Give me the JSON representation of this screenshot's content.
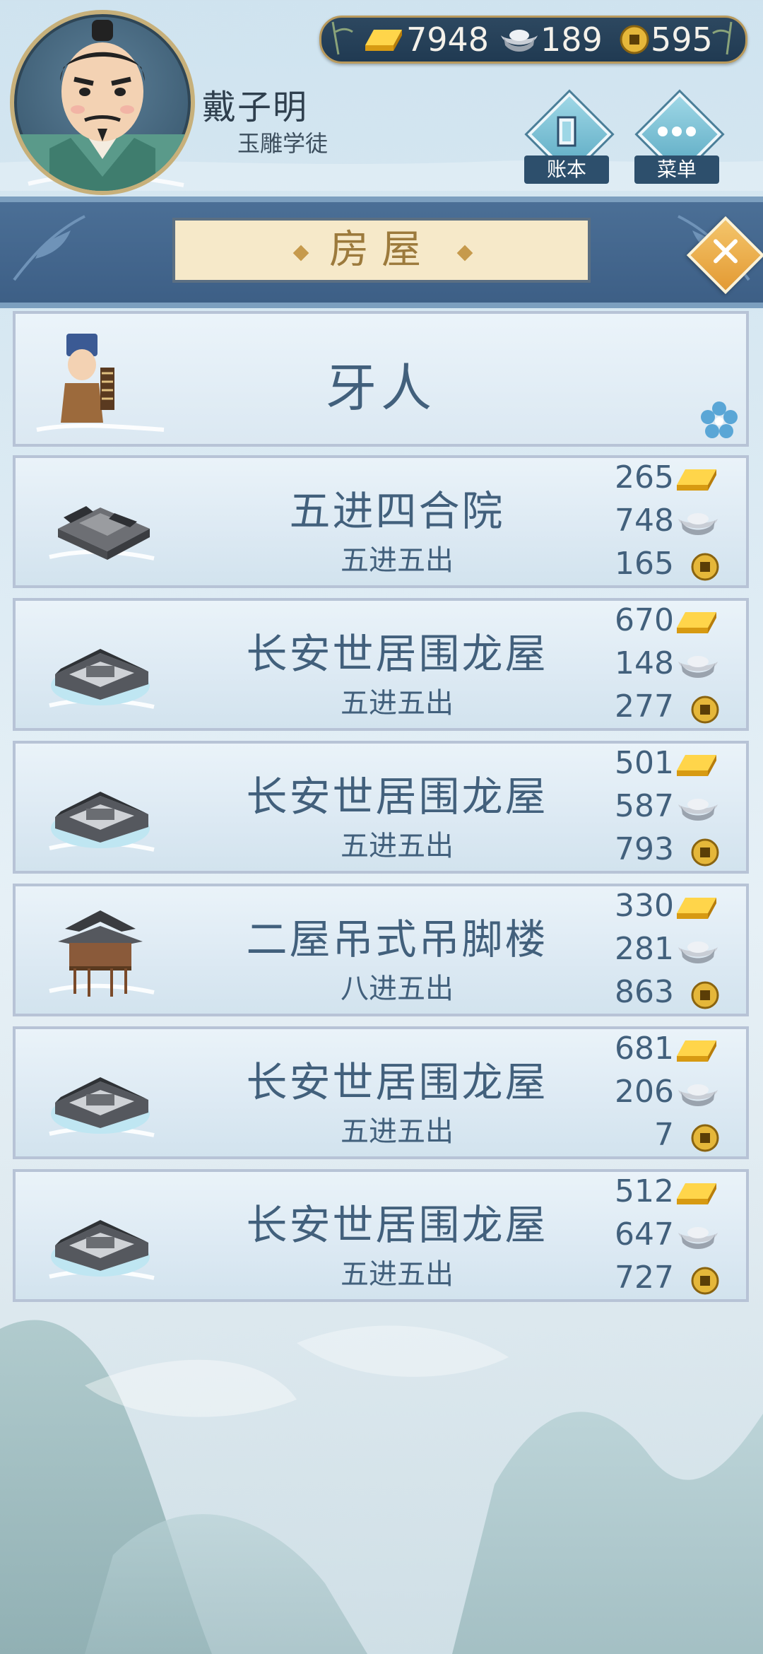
{
  "player": {
    "name": "戴子明",
    "title": "玉雕学徒"
  },
  "currency": {
    "gold": "7948",
    "silver": "189",
    "coin": "595"
  },
  "header_buttons": {
    "ledger": "账本",
    "menu": "菜单"
  },
  "panel": {
    "title": "房屋"
  },
  "agent": {
    "label": "牙人"
  },
  "houses": [
    {
      "name": "五进四合院",
      "sub": "五进五出",
      "gold": "265",
      "silver": "748",
      "coin": "165",
      "icon": "courtyard-house-icon"
    },
    {
      "name": "长安世居围龙屋",
      "sub": "五进五出",
      "gold": "670",
      "silver": "148",
      "coin": "277",
      "icon": "round-house-icon"
    },
    {
      "name": "长安世居围龙屋",
      "sub": "五进五出",
      "gold": "501",
      "silver": "587",
      "coin": "793",
      "icon": "round-house-icon"
    },
    {
      "name": "二屋吊式吊脚楼",
      "sub": "八进五出",
      "gold": "330",
      "silver": "281",
      "coin": "863",
      "icon": "stilt-house-icon"
    },
    {
      "name": "长安世居围龙屋",
      "sub": "五进五出",
      "gold": "681",
      "silver": "206",
      "coin": "7",
      "icon": "round-house-icon"
    },
    {
      "name": "长安世居围龙屋",
      "sub": "五进五出",
      "gold": "512",
      "silver": "647",
      "coin": "727",
      "icon": "round-house-icon"
    }
  ],
  "colors": {
    "text": "#42607c",
    "band": "#3d5f86",
    "accent": "#e39a33",
    "gold": "#f2b928"
  }
}
